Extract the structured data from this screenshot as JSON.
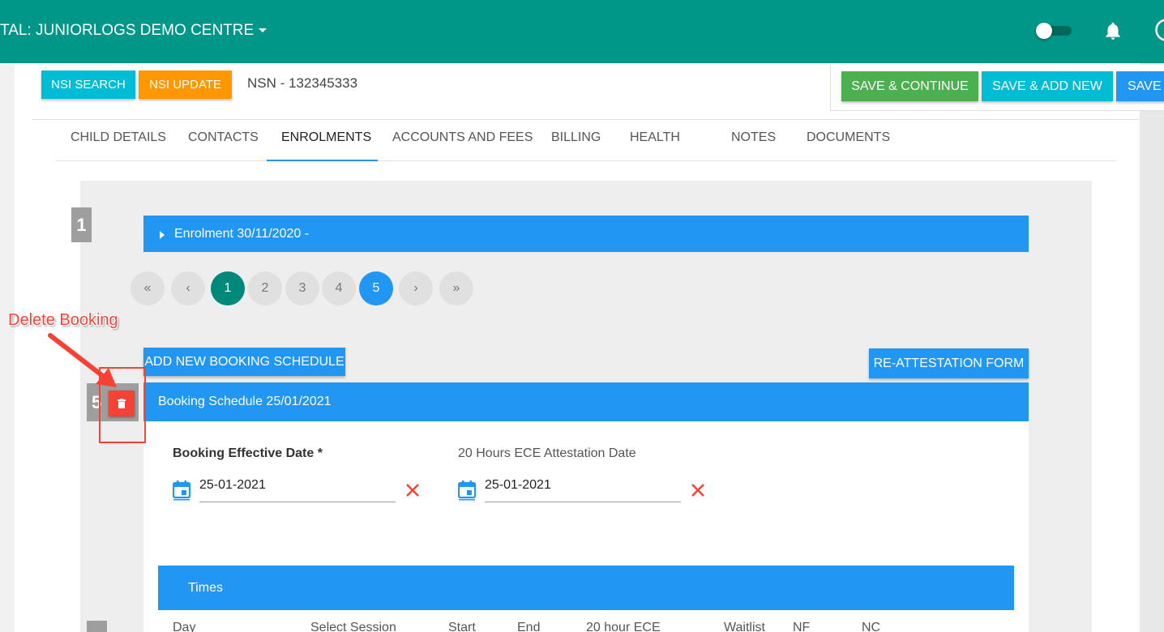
{
  "header": {
    "centre_title": "TAL: JUNIORLOGS DEMO CENTRE",
    "toggle_icon": "toggle-switch-icon",
    "bell_icon": "bell-icon",
    "user_icon": "account-circle-icon",
    "color": "#009688"
  },
  "toolbar": {
    "nsi_search": "NSI SEARCH",
    "nsi_update": "NSI UPDATE",
    "nsn": "NSN - 132345333",
    "save_continue": "SAVE & CONTINUE",
    "save_add_new": "SAVE & ADD NEW",
    "save": "SAVE",
    "colors": {
      "nsi_search": "#00bcd4",
      "nsi_update": "#ff9800",
      "save_continue": "#4caf50",
      "save_add_new": "#00bcd4",
      "save": "#2196f3"
    }
  },
  "tabs": [
    {
      "label": "CHILD DETAILS"
    },
    {
      "label": "CONTACTS"
    },
    {
      "label": "ENROLMENTS",
      "active": true
    },
    {
      "label": "ACCOUNTS AND FEES"
    },
    {
      "label": "BILLING"
    },
    {
      "label": "HEALTH"
    },
    {
      "label": "NOTES"
    },
    {
      "label": "DOCUMENTS"
    }
  ],
  "enrolment": {
    "number": "1",
    "title": "Enrolment 30/11/2020 -"
  },
  "pagination": {
    "first": "«",
    "prev": "‹",
    "pages": [
      "1",
      "2",
      "3",
      "4",
      "5"
    ],
    "current_page": "1",
    "selected_page": "5",
    "next": "›",
    "last": "»"
  },
  "booking": {
    "add_button": "ADD NEW BOOKING SCHEDULE",
    "reattestation_button": "RE-ATTESTATION FORM",
    "number": "5",
    "delete_icon": "trash-icon",
    "title": "Booking Schedule 25/01/2021",
    "effective_date_label": "Booking Effective Date *",
    "effective_date_value": "25-01-2021",
    "attestation_label": "20 Hours ECE Attestation Date",
    "attestation_value": "25-01-2021",
    "calendar_icon": "calendar-icon",
    "clear_icon": "close-icon"
  },
  "times": {
    "title": "Times",
    "columns": [
      "Day",
      "Select Session",
      "Start",
      "End",
      "20 hour ECE",
      "Waitlist",
      "NF",
      "NC"
    ]
  },
  "annotation": {
    "label": "Delete Booking",
    "color": "#f44336"
  }
}
